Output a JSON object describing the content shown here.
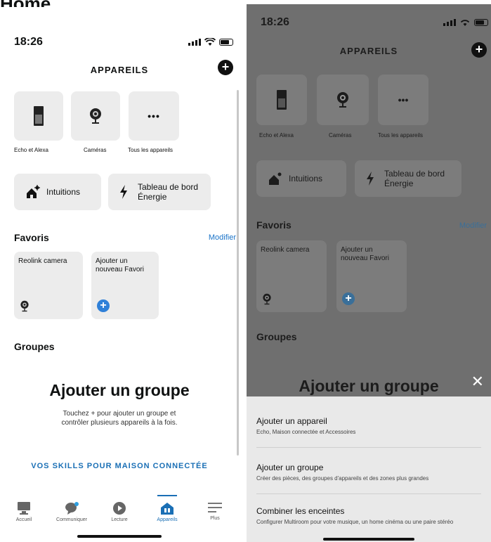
{
  "page_heading": "Home.",
  "status": {
    "time": "18:26"
  },
  "header": {
    "title": "APPAREILS",
    "add_symbol": "+"
  },
  "categories": [
    {
      "label": "Echo et Alexa",
      "icon": "echo-device-icon"
    },
    {
      "label": "Caméras",
      "icon": "camera-icon"
    },
    {
      "label": "Tous les appareils",
      "icon": "more-dots-icon",
      "glyph": "•••"
    }
  ],
  "shortcuts": [
    {
      "label": "Intuitions",
      "icon": "intuitions-icon"
    },
    {
      "label_line1": "Tableau de bord",
      "label_line2": "Énergie",
      "icon": "lightning-icon"
    }
  ],
  "favorites": {
    "title": "Favoris",
    "edit_link": "Modifier",
    "items": [
      {
        "label": "Reolink camera",
        "icon": "camera-icon"
      },
      {
        "label_line1": "Ajouter un",
        "label_line2": "nouveau Favori",
        "icon": "add-circle-icon",
        "glyph": "+"
      }
    ]
  },
  "groups": {
    "title": "Groupes",
    "empty_title": "Ajouter un groupe",
    "empty_line1": "Touchez + pour ajouter un groupe et",
    "empty_line2": "contrôler plusieurs appareils à la fois."
  },
  "skills_link": "VOS SKILLS POUR MAISON CONNECTÉE",
  "tabs": [
    {
      "label": "Accueil",
      "icon": "home-tab-icon",
      "active": false
    },
    {
      "label": "Communiquer",
      "icon": "chat-bubble-icon",
      "active": false
    },
    {
      "label": "Lecture",
      "icon": "play-icon",
      "active": false
    },
    {
      "label": "Appareils",
      "icon": "devices-home-icon",
      "active": true
    },
    {
      "label": "Plus",
      "icon": "menu-lines-icon",
      "active": false
    }
  ],
  "sheet": {
    "close_symbol": "✕",
    "items": [
      {
        "title": "Ajouter un appareil",
        "desc": "Echo, Maison connectée et Accessoires"
      },
      {
        "title": "Ajouter un groupe",
        "desc": "Créer des pièces, des groupes d'appareils et des zones plus grandes"
      },
      {
        "title": "Combiner les enceintes",
        "desc": "Configurer Multiroom pour votre musique, un home cinéma ou une paire stéréo"
      }
    ]
  },
  "colors": {
    "accent": "#1a6fb5",
    "link": "#1a73c8",
    "add_circle": "#2f80d8",
    "dim_overlay": "#6f6f6f"
  }
}
